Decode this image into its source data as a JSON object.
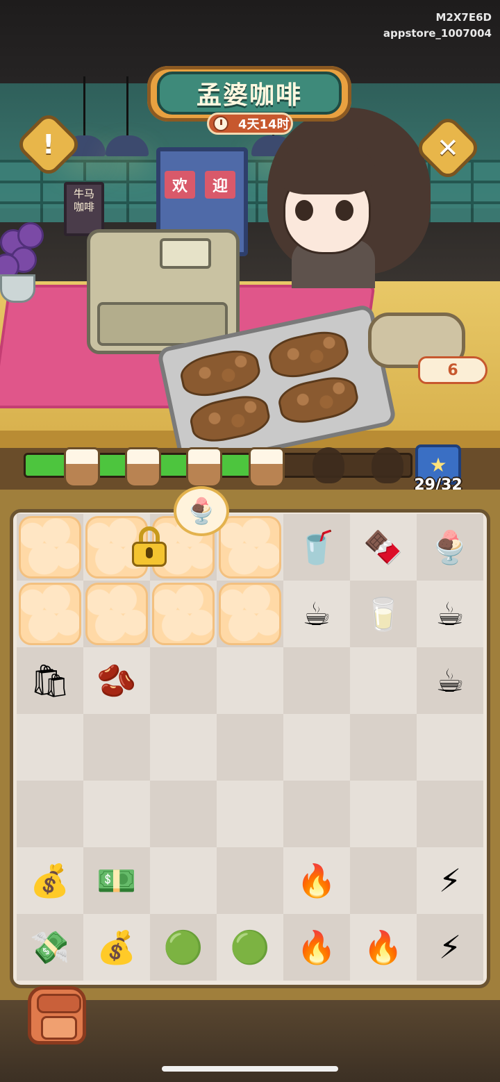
{
  "debug": {
    "device_id": "M2X7E6D",
    "channel": "appstore_1007004"
  },
  "shop": {
    "title": "孟婆咖啡",
    "timer": "4天14时"
  },
  "scene": {
    "door_sign": [
      "欢",
      "迎"
    ],
    "chalkboard_line1": "牛马",
    "chalkboard_line2": "咖啡",
    "counter_value": "6"
  },
  "buttons": {
    "info_icon": "exclamation-icon",
    "info_glyph": "!",
    "close_icon": "close-icon",
    "close_glyph": "✕"
  },
  "progress": {
    "fraction": 0.6,
    "current": 29,
    "total": 32,
    "label": "29/32",
    "milestones": [
      "done",
      "done",
      "done",
      "done",
      "locked",
      "locked"
    ],
    "book_icon": "star-book-icon",
    "book_glyph": "★"
  },
  "board": {
    "locked_bubble_icon": "ice-cream-sundae-icon",
    "locked_bubble_glyph": "🍨",
    "locked_icon": "padlock-icon",
    "cells": [
      [
        "fog",
        "fog",
        "fog",
        "fog",
        "iced-coffee-icon",
        "chocolate-cake-icon",
        "coffee-parfait-icon"
      ],
      [
        "fog",
        "fog",
        "fog",
        "fog",
        "coffee-cup-icon",
        "paper-cup-icon",
        "latte-art-cup-icon"
      ],
      [
        "coffee-bean-bag-icon",
        "coffee-pouch-icon",
        "",
        "",
        "",
        "",
        "espresso-cup-icon"
      ],
      [
        "",
        "",
        "",
        "",
        "",
        "",
        ""
      ],
      [
        "",
        "",
        "",
        "",
        "",
        "",
        ""
      ],
      [
        "cash-bowl-icon",
        "cash-bills-icon",
        "",
        "",
        "blue-flame-icon",
        "",
        "yellow-bolt-icon"
      ],
      [
        "cash-stack-icon",
        "money-bag-icon",
        "green-coins-icon",
        "green-coins-small-icon",
        "blue-flame-double-icon",
        "blue-flame-triple-icon",
        "yellow-bolt-double-icon"
      ]
    ],
    "glyphs": {
      "iced-coffee-icon": "🥤",
      "chocolate-cake-icon": "🍫",
      "coffee-parfait-icon": "🍨",
      "coffee-cup-icon": "☕",
      "paper-cup-icon": "🥛",
      "latte-art-cup-icon": "☕",
      "coffee-bean-bag-icon": "🛍",
      "coffee-pouch-icon": "🫘",
      "espresso-cup-icon": "☕",
      "cash-bowl-icon": "💰",
      "cash-bills-icon": "💵",
      "blue-flame-icon": "🔥",
      "yellow-bolt-icon": "⚡",
      "cash-stack-icon": "💸",
      "money-bag-icon": "💰",
      "green-coins-icon": "🟢",
      "green-coins-small-icon": "🟢",
      "blue-flame-double-icon": "🔥",
      "blue-flame-triple-icon": "🔥",
      "yellow-bolt-double-icon": "⚡"
    }
  },
  "inventory": {
    "icon": "backpack-icon"
  },
  "colors": {
    "progress_fill": "#4dc53e",
    "sign_bg": "#3e8a7a",
    "timer_bg": "#c7582e"
  }
}
